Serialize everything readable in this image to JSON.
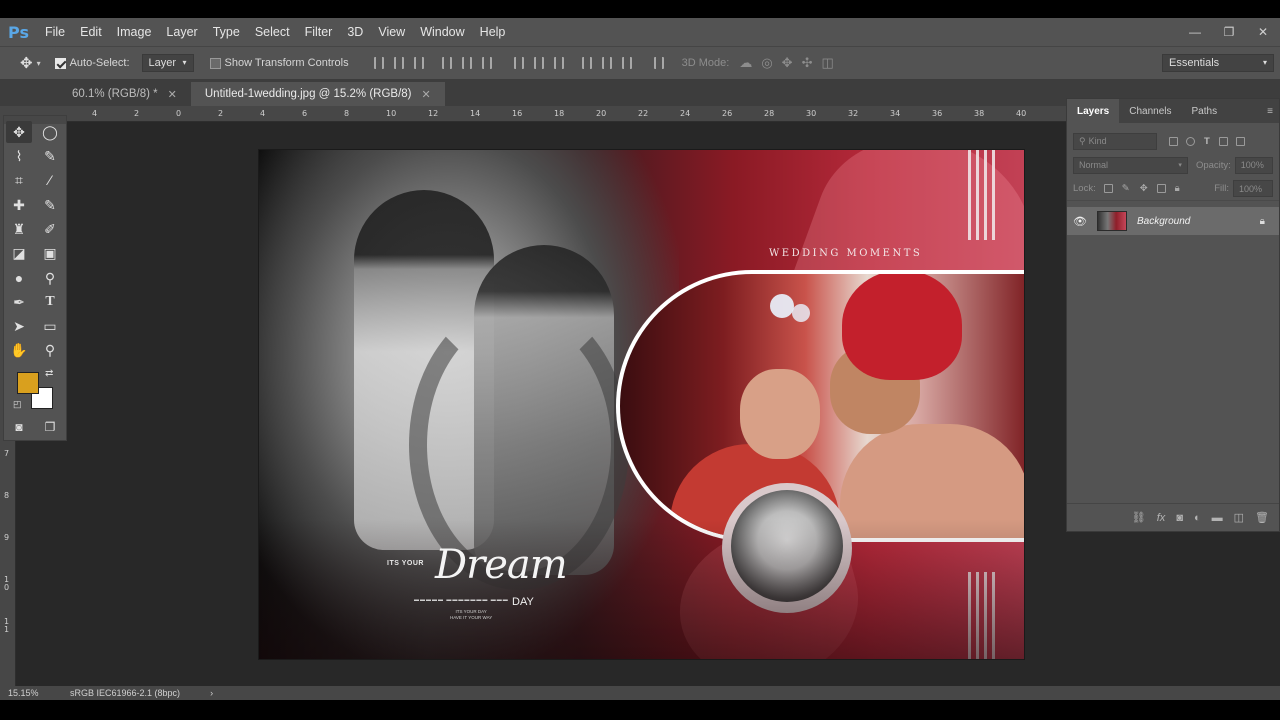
{
  "app": {
    "logo": "Ps"
  },
  "menu": [
    "File",
    "Edit",
    "Image",
    "Layer",
    "Type",
    "Select",
    "Filter",
    "3D",
    "View",
    "Window",
    "Help"
  ],
  "window_controls": {
    "minimize": "—",
    "restore": "❐",
    "close": "✕"
  },
  "options": {
    "auto_select_label": "Auto-Select:",
    "auto_select_checked": true,
    "auto_select_target": "Layer",
    "show_transform_label": "Show Transform Controls",
    "mode_3d_label": "3D Mode:",
    "workspace": "Essentials"
  },
  "tabs": [
    {
      "label": "60.1% (RGB/8) *",
      "active": false
    },
    {
      "label": "Untitled-1wedding.jpg @ 15.2% (RGB/8)",
      "active": true
    }
  ],
  "ruler_h": [
    "4",
    "2",
    "0",
    "2",
    "4",
    "6",
    "8",
    "10",
    "12",
    "14",
    "16",
    "18",
    "20",
    "22",
    "24",
    "26",
    "28",
    "30",
    "32",
    "34",
    "36",
    "38",
    "40"
  ],
  "ruler_v": [
    "7",
    "8",
    "9",
    "1 0",
    "1 1"
  ],
  "colors": {
    "foreground": "#d9a01e",
    "background": "#ffffff"
  },
  "canvas": {
    "title": "WEDDING MOMENTS",
    "its_your": "ITS YOUR",
    "dream": "Dream",
    "day": "DAY",
    "sub_line1": "▬▬▬▬▬ ▬▬▬▬▬▬▬ ▬▬▬",
    "sub_line2a": "ITS YOUR DAY",
    "sub_line2b": "HAVE IT YOUR WAY"
  },
  "layers_panel": {
    "tabs": [
      "Layers",
      "Channels",
      "Paths"
    ],
    "filter_kind": "Kind",
    "blend_mode": "Normal",
    "opacity_label": "Opacity:",
    "opacity_value": "100%",
    "lock_label": "Lock:",
    "fill_label": "Fill:",
    "fill_value": "100%",
    "layers": [
      {
        "name": "Background",
        "visible": true,
        "locked": true
      }
    ]
  },
  "status": {
    "zoom": "15.15%",
    "doc_info": "sRGB IEC61966-2.1 (8bpc)"
  }
}
